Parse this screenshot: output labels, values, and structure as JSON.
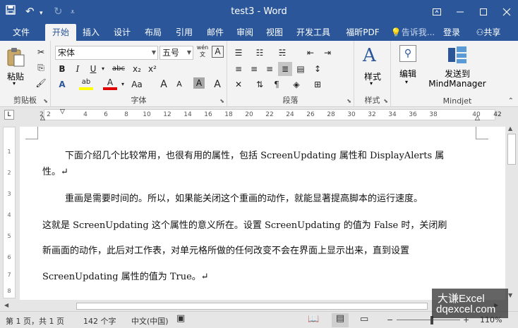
{
  "titlebar": {
    "title": "test3 - Word",
    "save_icon": "save-icon",
    "undo_icon": "undo-icon",
    "redo_icon": "redo-icon",
    "customize_icon": "customize-quick-access-icon",
    "controls": [
      "ribbon-display-options-icon",
      "minimize-icon",
      "maximize-icon",
      "close-icon"
    ]
  },
  "tabs": [
    {
      "label": "文件"
    },
    {
      "label": "开始"
    },
    {
      "label": "插入"
    },
    {
      "label": "设计"
    },
    {
      "label": "布局"
    },
    {
      "label": "引用"
    },
    {
      "label": "邮件"
    },
    {
      "label": "审阅"
    },
    {
      "label": "视图"
    },
    {
      "label": "开发工具"
    },
    {
      "label": "福昕PDF"
    }
  ],
  "active_tab": "开始",
  "tell_me": "告诉我...",
  "login": "登录",
  "share": "共享",
  "ribbon": {
    "clipboard": {
      "label": "剪贴板",
      "paste": "粘贴"
    },
    "font": {
      "label": "字体",
      "name": "宋体",
      "size": "五号",
      "wen": "wén",
      "bold": "B",
      "italic": "I",
      "underline": "U",
      "strike": "abc",
      "sub": "x₂",
      "sup": "x²",
      "grow": "A",
      "shrink": "A",
      "char_shading": "A",
      "char_border": "A",
      "highlight": "ab",
      "font_color": "A",
      "clear": "A",
      "aa": "Aa"
    },
    "paragraph": {
      "label": "段落"
    },
    "styles": {
      "label": "样式",
      "button": "样式"
    },
    "editing": {
      "button": "编辑"
    },
    "mindjet": {
      "label": "Mindjet",
      "button_line1": "发送到",
      "button_line2": "MindManager"
    }
  },
  "ruler": {
    "numbers": [
      "2",
      "2",
      "4",
      "6",
      "8",
      "10",
      "12",
      "14",
      "16",
      "18",
      "20",
      "22",
      "24",
      "26",
      "28",
      "30",
      "32",
      "34",
      "36",
      "38",
      "40",
      "42"
    ]
  },
  "vruler": {
    "numbers": [
      "1",
      "2",
      "3",
      "4",
      "5",
      "6",
      "7",
      "8"
    ]
  },
  "document": {
    "paragraphs": [
      "下面介绍几个比较常用，也很有用的属性，包括 ScreenUpdating 属性和 DisplayAlerts 属",
      "性。↵",
      "重画是需要时间的。所以，如果能关闭这个重画的动作，就能显著提高脚本的运行速度。",
      "这就是 ScreenUpdating 这个属性的意义所在。设置 ScreenUpdating 的值为 False 时，关闭刷",
      "新画面的动作，此后对工作表，对单元格所做的任何改变不会在界面上显示出来，直到设置",
      "ScreenUpdating 属性的值为 True。↵"
    ]
  },
  "status": {
    "page": "第 1 页，共 1 页",
    "words": "142 个字",
    "lang": "中文(中国)",
    "zoom": "110%"
  },
  "watermark": {
    "line1": "大谦Excel",
    "line2": "dqexcel.com"
  }
}
